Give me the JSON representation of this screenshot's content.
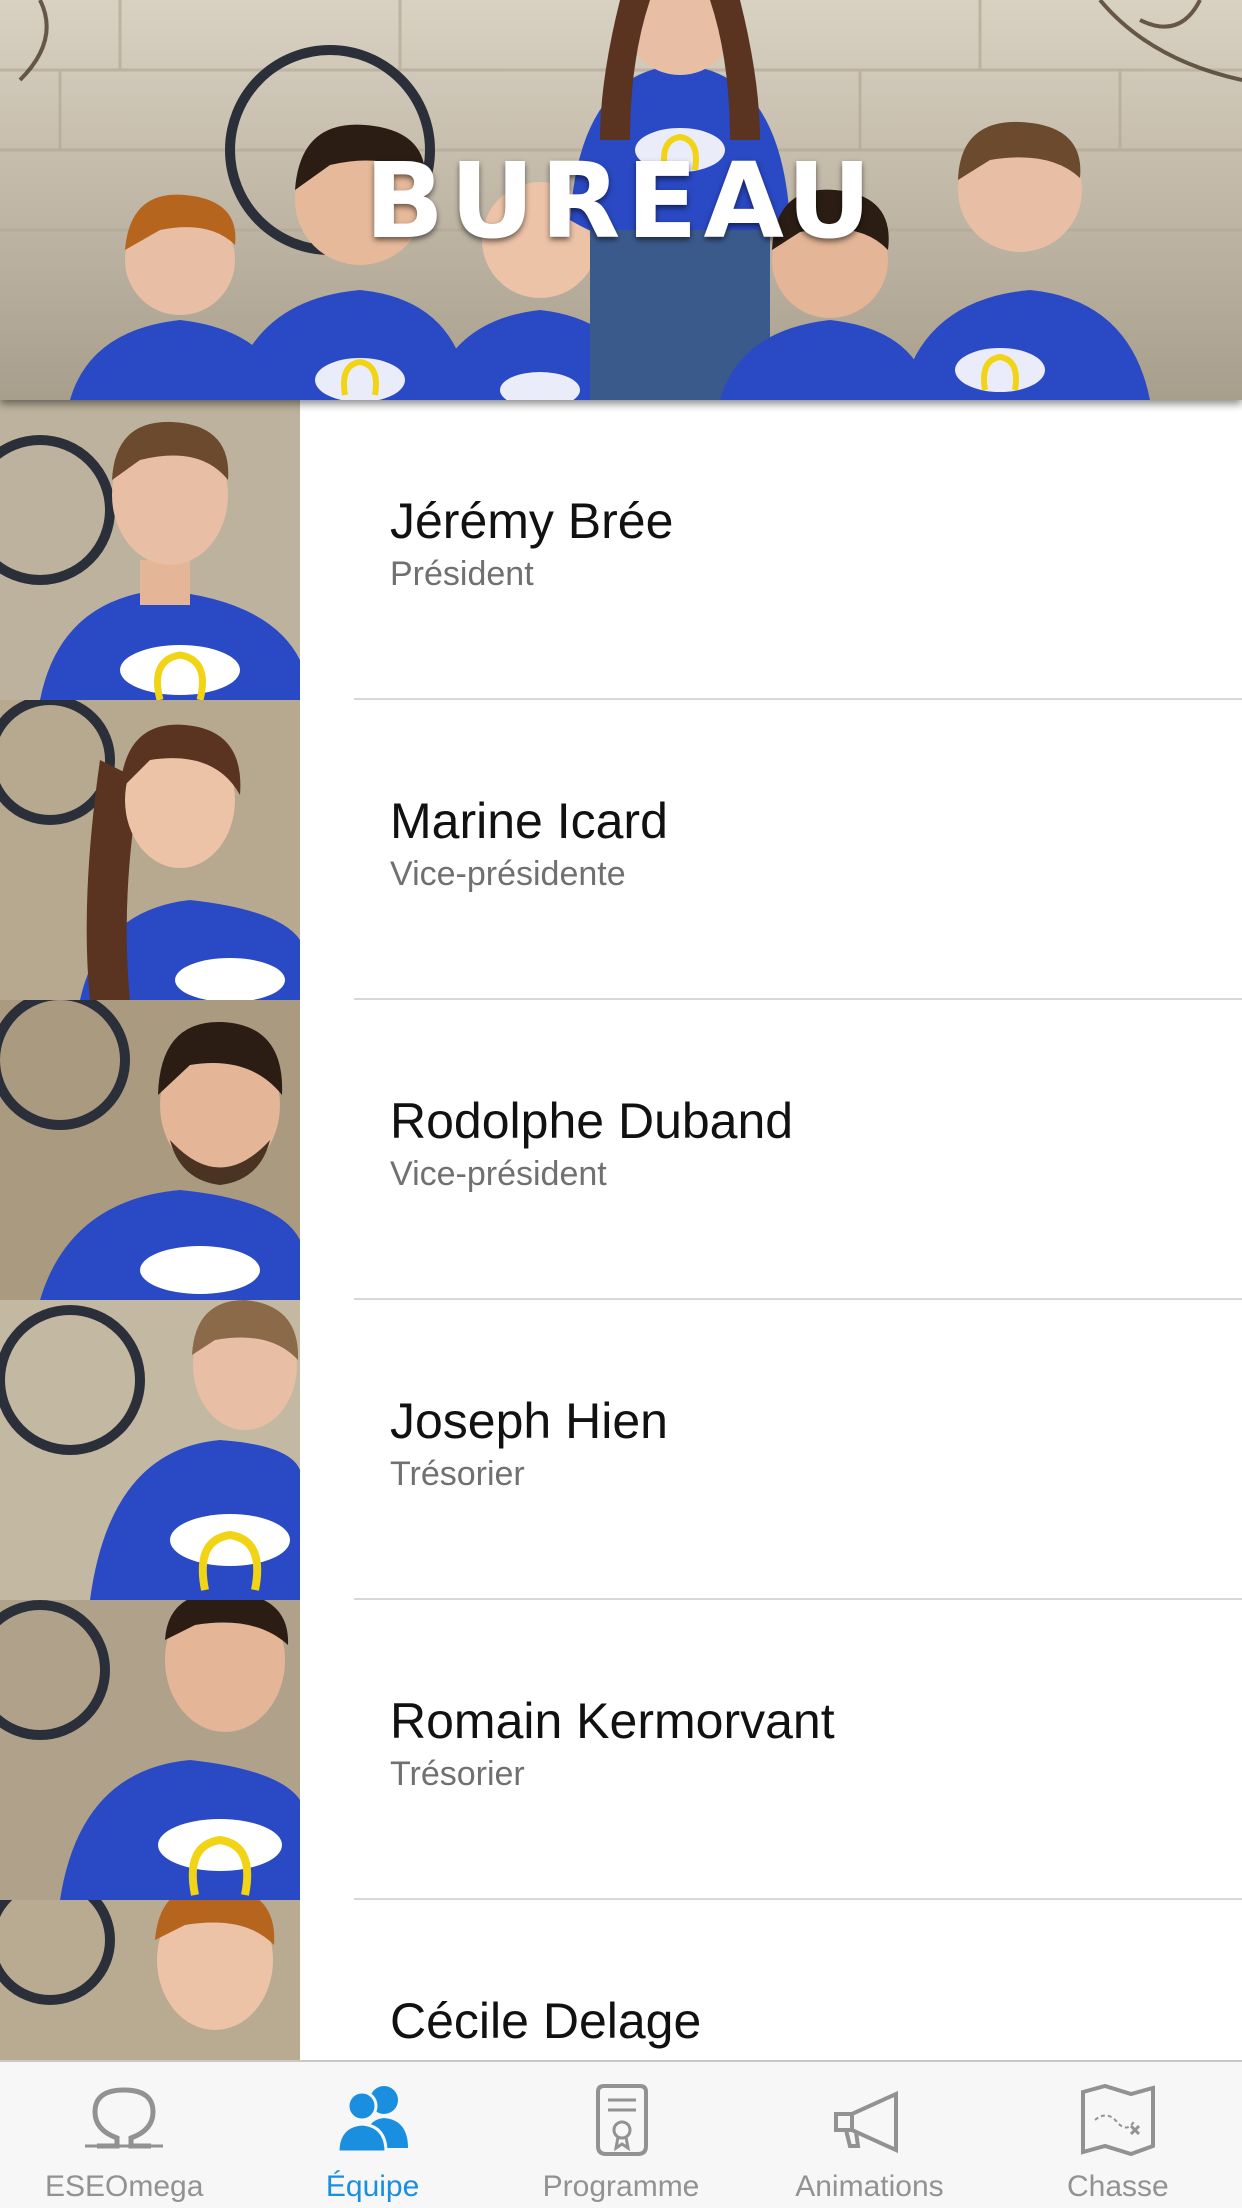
{
  "header": {
    "title": "BUREAU",
    "photo_description": "group-photo-eseomega"
  },
  "members": [
    {
      "name": "Jérémy Brée",
      "role": "Président",
      "photo": "member-photo"
    },
    {
      "name": "Marine Icard",
      "role": "Vice-présidente",
      "photo": "member-photo"
    },
    {
      "name": "Rodolphe Duband",
      "role": "Vice-président",
      "photo": "member-photo"
    },
    {
      "name": "Joseph Hien",
      "role": "Trésorier",
      "photo": "member-photo"
    },
    {
      "name": "Romain Kermorvant",
      "role": "Trésorier",
      "photo": "member-photo"
    },
    {
      "name": "Cécile Delage",
      "role": "",
      "photo": "member-photo"
    }
  ],
  "tabbar": {
    "tabs": [
      {
        "label": "ESEOmega",
        "icon": "omega-icon",
        "active": false
      },
      {
        "label": "Équipe",
        "icon": "team-icon",
        "active": true
      },
      {
        "label": "Programme",
        "icon": "scroll-icon",
        "active": false
      },
      {
        "label": "Animations",
        "icon": "megaphone-icon",
        "active": false
      },
      {
        "label": "Chasse",
        "icon": "treasure-map-icon",
        "active": false
      }
    ]
  },
  "colors": {
    "accent": "#1a8fe0",
    "inactive": "#929292",
    "tshirt": "#2a49c4",
    "wall": "#c9c0ae"
  }
}
